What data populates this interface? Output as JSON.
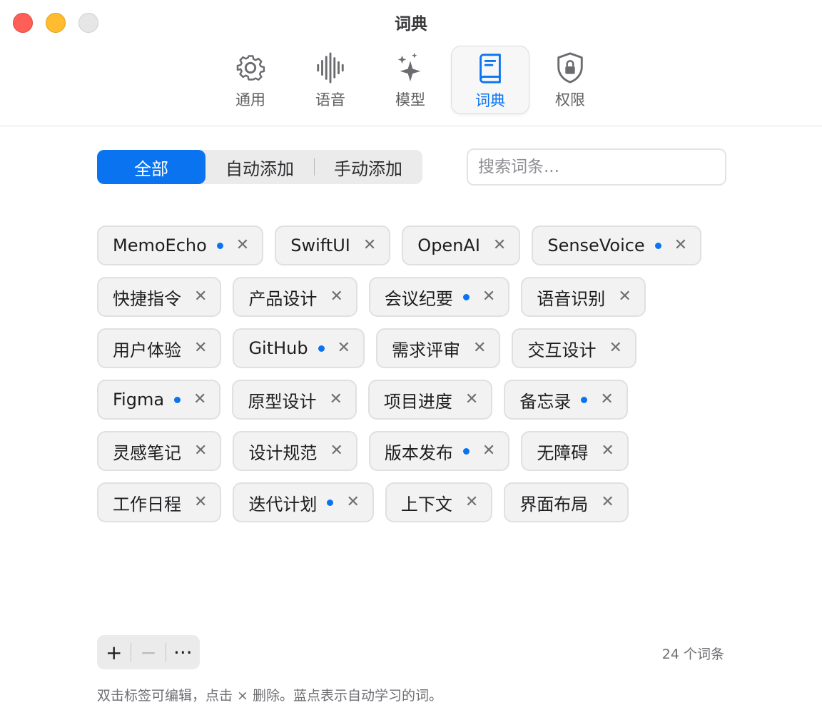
{
  "window": {
    "title": "词典"
  },
  "toolbar": {
    "tabs": [
      {
        "label": "通用",
        "icon": "gear-icon"
      },
      {
        "label": "语音",
        "icon": "waveform-icon"
      },
      {
        "label": "模型",
        "icon": "sparkles-icon"
      },
      {
        "label": "词典",
        "icon": "book-icon",
        "active": true
      },
      {
        "label": "权限",
        "icon": "lock-shield-icon"
      }
    ]
  },
  "filter": {
    "segments": [
      "全部",
      "自动添加",
      "手动添加"
    ],
    "selected": "全部"
  },
  "search": {
    "placeholder": "搜索词条...",
    "value": ""
  },
  "tags": [
    {
      "text": "MemoEcho",
      "auto": true
    },
    {
      "text": "SwiftUI",
      "auto": false
    },
    {
      "text": "OpenAI",
      "auto": false
    },
    {
      "text": "SenseVoice",
      "auto": true
    },
    {
      "text": "快捷指令",
      "auto": false
    },
    {
      "text": "产品设计",
      "auto": false
    },
    {
      "text": "会议纪要",
      "auto": true
    },
    {
      "text": "语音识别",
      "auto": false
    },
    {
      "text": "用户体验",
      "auto": false
    },
    {
      "text": "GitHub",
      "auto": true
    },
    {
      "text": "需求评审",
      "auto": false
    },
    {
      "text": "交互设计",
      "auto": false
    },
    {
      "text": "Figma",
      "auto": true
    },
    {
      "text": "原型设计",
      "auto": false
    },
    {
      "text": "项目进度",
      "auto": false
    },
    {
      "text": "备忘录",
      "auto": true
    },
    {
      "text": "灵感笔记",
      "auto": false
    },
    {
      "text": "设计规范",
      "auto": false
    },
    {
      "text": "版本发布",
      "auto": true
    },
    {
      "text": "无障碍",
      "auto": false
    },
    {
      "text": "工作日程",
      "auto": false
    },
    {
      "text": "迭代计划",
      "auto": true
    },
    {
      "text": "上下文",
      "auto": false
    },
    {
      "text": "界面布局",
      "auto": false
    }
  ],
  "bottom": {
    "add_label": "+",
    "remove_label": "−",
    "more_label": "···",
    "count_text": "24 个词条",
    "hint": "双击标签可编辑，点击 × 删除。蓝点表示自动学习的词。"
  },
  "colors": {
    "accent": "#0a74f0",
    "close": "#ff5f57",
    "minimize": "#febc2e"
  }
}
